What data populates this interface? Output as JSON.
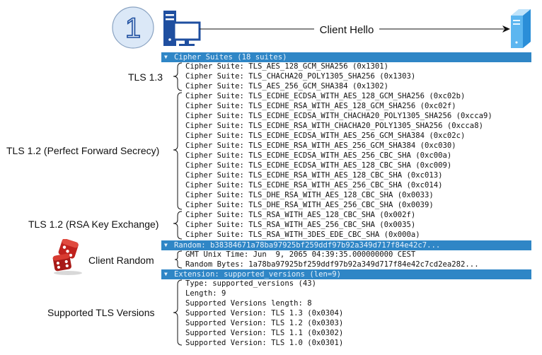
{
  "step": {
    "number": "1"
  },
  "message": {
    "label": "Client Hello"
  },
  "cipher_suites": {
    "header": "Cipher Suites (18 suites)",
    "groups": [
      {
        "label": "TLS 1.3",
        "items": [
          "Cipher Suite: TLS_AES_128_GCM_SHA256 (0x1301)",
          "Cipher Suite: TLS_CHACHA20_POLY1305_SHA256 (0x1303)",
          "Cipher Suite: TLS_AES_256_GCM_SHA384 (0x1302)"
        ]
      },
      {
        "label": "TLS 1.2 (Perfect Forward Secrecy)",
        "items": [
          "Cipher Suite: TLS_ECDHE_ECDSA_WITH_AES_128_GCM_SHA256 (0xc02b)",
          "Cipher Suite: TLS_ECDHE_RSA_WITH_AES_128_GCM_SHA256 (0xc02f)",
          "Cipher Suite: TLS_ECDHE_ECDSA_WITH_CHACHA20_POLY1305_SHA256 (0xcca9)",
          "Cipher Suite: TLS_ECDHE_RSA_WITH_CHACHA20_POLY1305_SHA256 (0xcca8)",
          "Cipher Suite: TLS_ECDHE_ECDSA_WITH_AES_256_GCM_SHA384 (0xc02c)",
          "Cipher Suite: TLS_ECDHE_RSA_WITH_AES_256_GCM_SHA384 (0xc030)",
          "Cipher Suite: TLS_ECDHE_ECDSA_WITH_AES_256_CBC_SHA (0xc00a)",
          "Cipher Suite: TLS_ECDHE_ECDSA_WITH_AES_128_CBC_SHA (0xc009)",
          "Cipher Suite: TLS_ECDHE_RSA_WITH_AES_128_CBC_SHA (0xc013)",
          "Cipher Suite: TLS_ECDHE_RSA_WITH_AES_256_CBC_SHA (0xc014)",
          "Cipher Suite: TLS_DHE_RSA_WITH_AES_128_CBC_SHA (0x0033)",
          "Cipher Suite: TLS_DHE_RSA_WITH_AES_256_CBC_SHA (0x0039)"
        ]
      },
      {
        "label": "TLS 1.2 (RSA Key Exchange)",
        "items": [
          "Cipher Suite: TLS_RSA_WITH_AES_128_CBC_SHA (0x002f)",
          "Cipher Suite: TLS_RSA_WITH_AES_256_CBC_SHA (0x0035)",
          "Cipher Suite: TLS_RSA_WITH_3DES_EDE_CBC_SHA (0x000a)"
        ]
      }
    ]
  },
  "random": {
    "header": "Random: b38384671a78ba97925bf259ddf97b92a349d717f84e42c7...",
    "label": "Client Random",
    "items": [
      "GMT Unix Time: Jun  9, 2065 04:39:35.000000000 CEST",
      "Random Bytes: 1a78ba97925bf259ddf97b92a349d717f84e42c7cd2ea282..."
    ]
  },
  "extension": {
    "header": "Extension: supported_versions (len=9)",
    "label": "Supported TLS Versions",
    "items": [
      "Type: supported_versions (43)",
      "Length: 9",
      "Supported Versions length: 8",
      "Supported Version: TLS 1.3 (0x0304)",
      "Supported Version: TLS 1.2 (0x0303)",
      "Supported Version: TLS 1.1 (0x0302)",
      "Supported Version: TLS 1.0 (0x0301)"
    ]
  },
  "colors": {
    "header_bg": "#2f86c6",
    "icon_blue": "#1f4fa0",
    "circle_fill": "#dbe8f7",
    "dice_red": "#c0221e"
  },
  "icons": {
    "client": "computer-icon",
    "server": "server-icon",
    "random": "dice-icon"
  }
}
